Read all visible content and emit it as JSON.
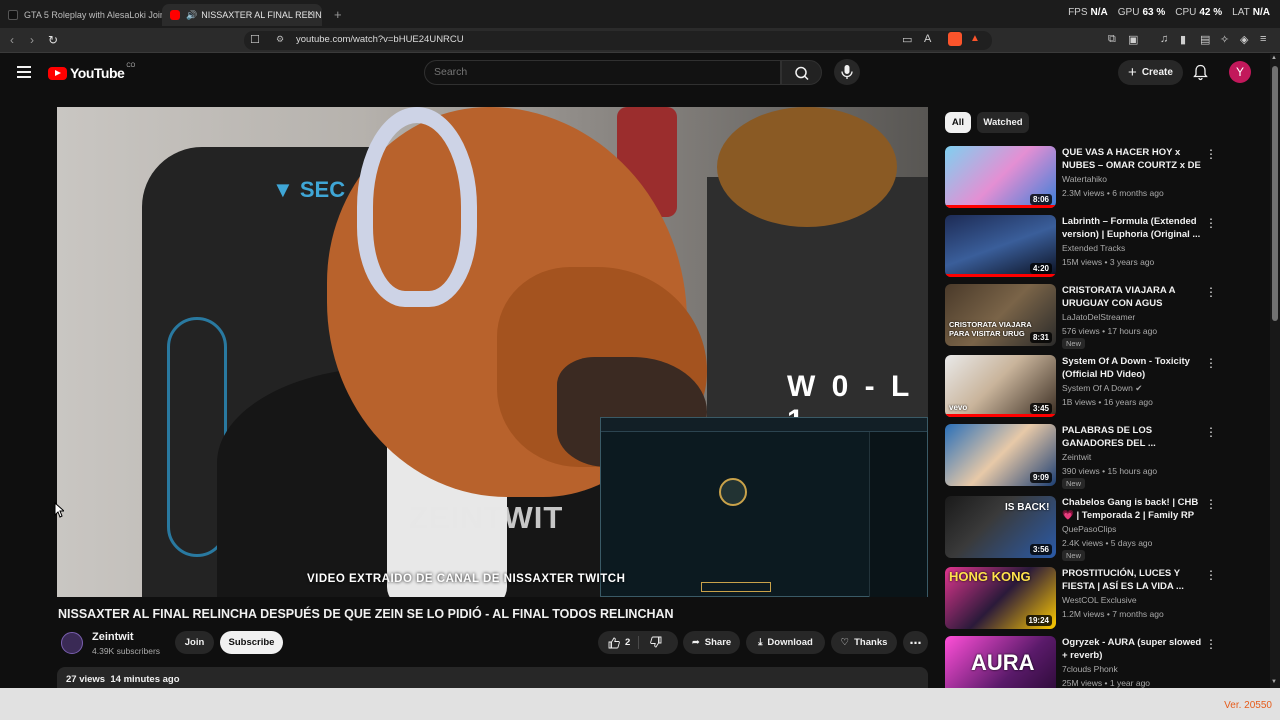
{
  "browser": {
    "tabs": [
      {
        "label": "GTA 5 Roleplay with AlesaLoki Join"
      },
      {
        "label": "NISSAXTER AL FINAL RELINCH"
      }
    ],
    "url": "youtube.com/watch?v=bHUE24UNRCU",
    "stats": {
      "fps_label": "FPS",
      "fps_value": "N/A",
      "gpu_label": "GPU",
      "gpu_value": "63 %",
      "cpu_label": "CPU",
      "cpu_value": "42 %",
      "lat_label": "LAT",
      "lat_value": "N/A"
    }
  },
  "header": {
    "logo": "YouTube",
    "logo_country": "CO",
    "search_placeholder": "Search",
    "create_label": "Create",
    "avatar_letter": "Y"
  },
  "player": {
    "overlay_score": "W 0 - L 1",
    "overlay_watermark": "ZEINTWIT",
    "overlay_caption": "VIDEO EXTRAIDO DE CANAL DE NISSAXTER TWITCH"
  },
  "video": {
    "title": "NISSAXTER AL FINAL RELINCHA DESPUÉS DE QUE ZEIN SE LO PIDIÓ - AL FINAL TODOS RELINCHAN",
    "channel": "Zeintwit",
    "subscribers": "4.39K subscribers",
    "join": "Join",
    "subscribe": "Subscribe",
    "likes": "2",
    "share": "Share",
    "download": "Download",
    "thanks": "Thanks",
    "views": "27 views",
    "time_ago": "14 minutes ago"
  },
  "filters": {
    "all": "All",
    "watched": "Watched"
  },
  "recommendations": [
    {
      "title": "QUE VAS A HACER HOY x NUBES – OMAR COURTZ x DE ...",
      "channel": "Watertahiko",
      "meta": "2.3M views • 6 months ago",
      "duration": "8:06",
      "badge": "",
      "progress": 1.0
    },
    {
      "title": "Labrinth – Formula (Extended version) | Euphoria (Original ...",
      "channel": "Extended Tracks",
      "meta": "15M views • 3 years ago",
      "duration": "4:20",
      "badge": "",
      "progress": 1.0
    },
    {
      "title": "CRISTORATA VIAJARA A URUGUAY CON AGUS PADILLA",
      "channel": "LaJatoDelStreamer",
      "meta": "576 views • 17 hours ago",
      "duration": "8:31",
      "badge": "New",
      "progress": 0.0,
      "thumb_text": "CRISTORATA VIAJARA PARA VISITAR URUG"
    },
    {
      "title": "System Of A Down - Toxicity (Official HD Video)",
      "channel": "System Of A Down",
      "meta": "1B views • 16 years ago",
      "duration": "3:45",
      "badge": "",
      "progress": 1.0,
      "thumb_text": "vevo"
    },
    {
      "title": "PALABRAS DE LOS GANADORES DEL ...",
      "channel": "Zeintwit",
      "meta": "390 views • 15 hours ago",
      "duration": "9:09",
      "badge": "New",
      "progress": 0.0
    },
    {
      "title": "Chabelos Gang is back! | CHB 💗 | Temporada 2 | Family RP",
      "channel": "QuePasoClips",
      "meta": "2.4K views • 5 days ago",
      "duration": "3:56",
      "badge": "New",
      "progress": 0.0,
      "thumb_text": "IS BACK!"
    },
    {
      "title": "PROSTITUCIÓN, LUCES Y FIESTA | ASÍ ES LA VIDA ...",
      "channel": "WestCOL Exclusive",
      "meta": "1.2M views • 7 months ago",
      "duration": "19:24",
      "badge": "",
      "progress": 0.0,
      "thumb_text": "HONG KONG"
    },
    {
      "title": "Ogryzek - AURA (super slowed + reverb)",
      "channel": "7clouds Phonk",
      "meta": "25M views • 1 year ago",
      "duration": "",
      "badge": "",
      "progress": 0.0,
      "thumb_text": "AURA"
    }
  ],
  "footer": {
    "version": "Ver. 20550"
  },
  "colors": {
    "accent": "#ff0000",
    "background": "#0f0f0f",
    "chip_active": "#f1f1f1",
    "brave": "#fb542b",
    "version_text": "#e65c1b"
  }
}
